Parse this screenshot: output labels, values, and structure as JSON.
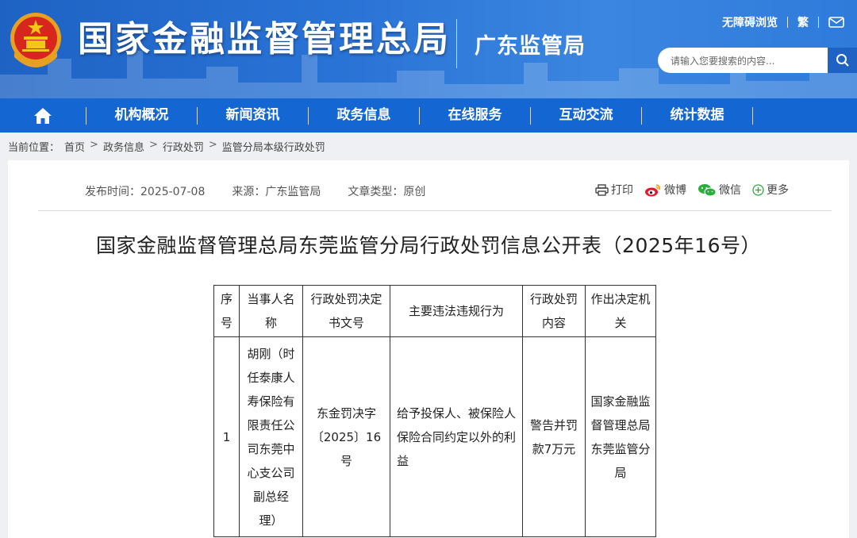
{
  "header": {
    "org_name": "国家金融监督管理总局",
    "sub_org": "广东监管局",
    "accessible_link": "无障碍浏览",
    "traditional_link": "繁",
    "search_placeholder": "请输入您要搜索的内容..."
  },
  "nav": {
    "items": [
      {
        "label": "机构概况"
      },
      {
        "label": "新闻资讯"
      },
      {
        "label": "政务信息"
      },
      {
        "label": "在线服务"
      },
      {
        "label": "互动交流"
      },
      {
        "label": "统计数据"
      }
    ]
  },
  "breadcrumb": {
    "prefix": "当前位置：",
    "items": [
      "首页",
      "政务信息",
      "行政处罚",
      "监管分局本级行政处罚"
    ],
    "sep": ">"
  },
  "article": {
    "publish_time": "发布时间：2025-07-08",
    "source": "来源：广东监管局",
    "type": "文章类型：原创",
    "share": {
      "print": "打印",
      "weibo": "微博",
      "wechat": "微信",
      "more": "更多"
    },
    "title": "国家金融监督管理总局东莞监管分局行政处罚信息公开表（2025年16号）"
  },
  "table": {
    "headers": [
      "序号",
      "当事人名称",
      "行政处罚决定书文号",
      "主要违法违规行为",
      "行政处罚内容",
      "作出决定机关"
    ],
    "rows": [
      {
        "no": "1",
        "party": "胡刚（时任泰康人寿保险有限责任公司东莞中心支公司副总经理）",
        "doc_no": "东金罚决字〔2025〕16号",
        "violation": "给予投保人、被保险人保险合同约定以外的利益",
        "penalty": "警告并罚款7万元",
        "authority": "国家金融监督管理总局东莞监管分局"
      }
    ]
  },
  "colors": {
    "header_blue": "#2a73d6",
    "nav_blue": "#1466d2",
    "page_bg": "#eef0f3"
  }
}
